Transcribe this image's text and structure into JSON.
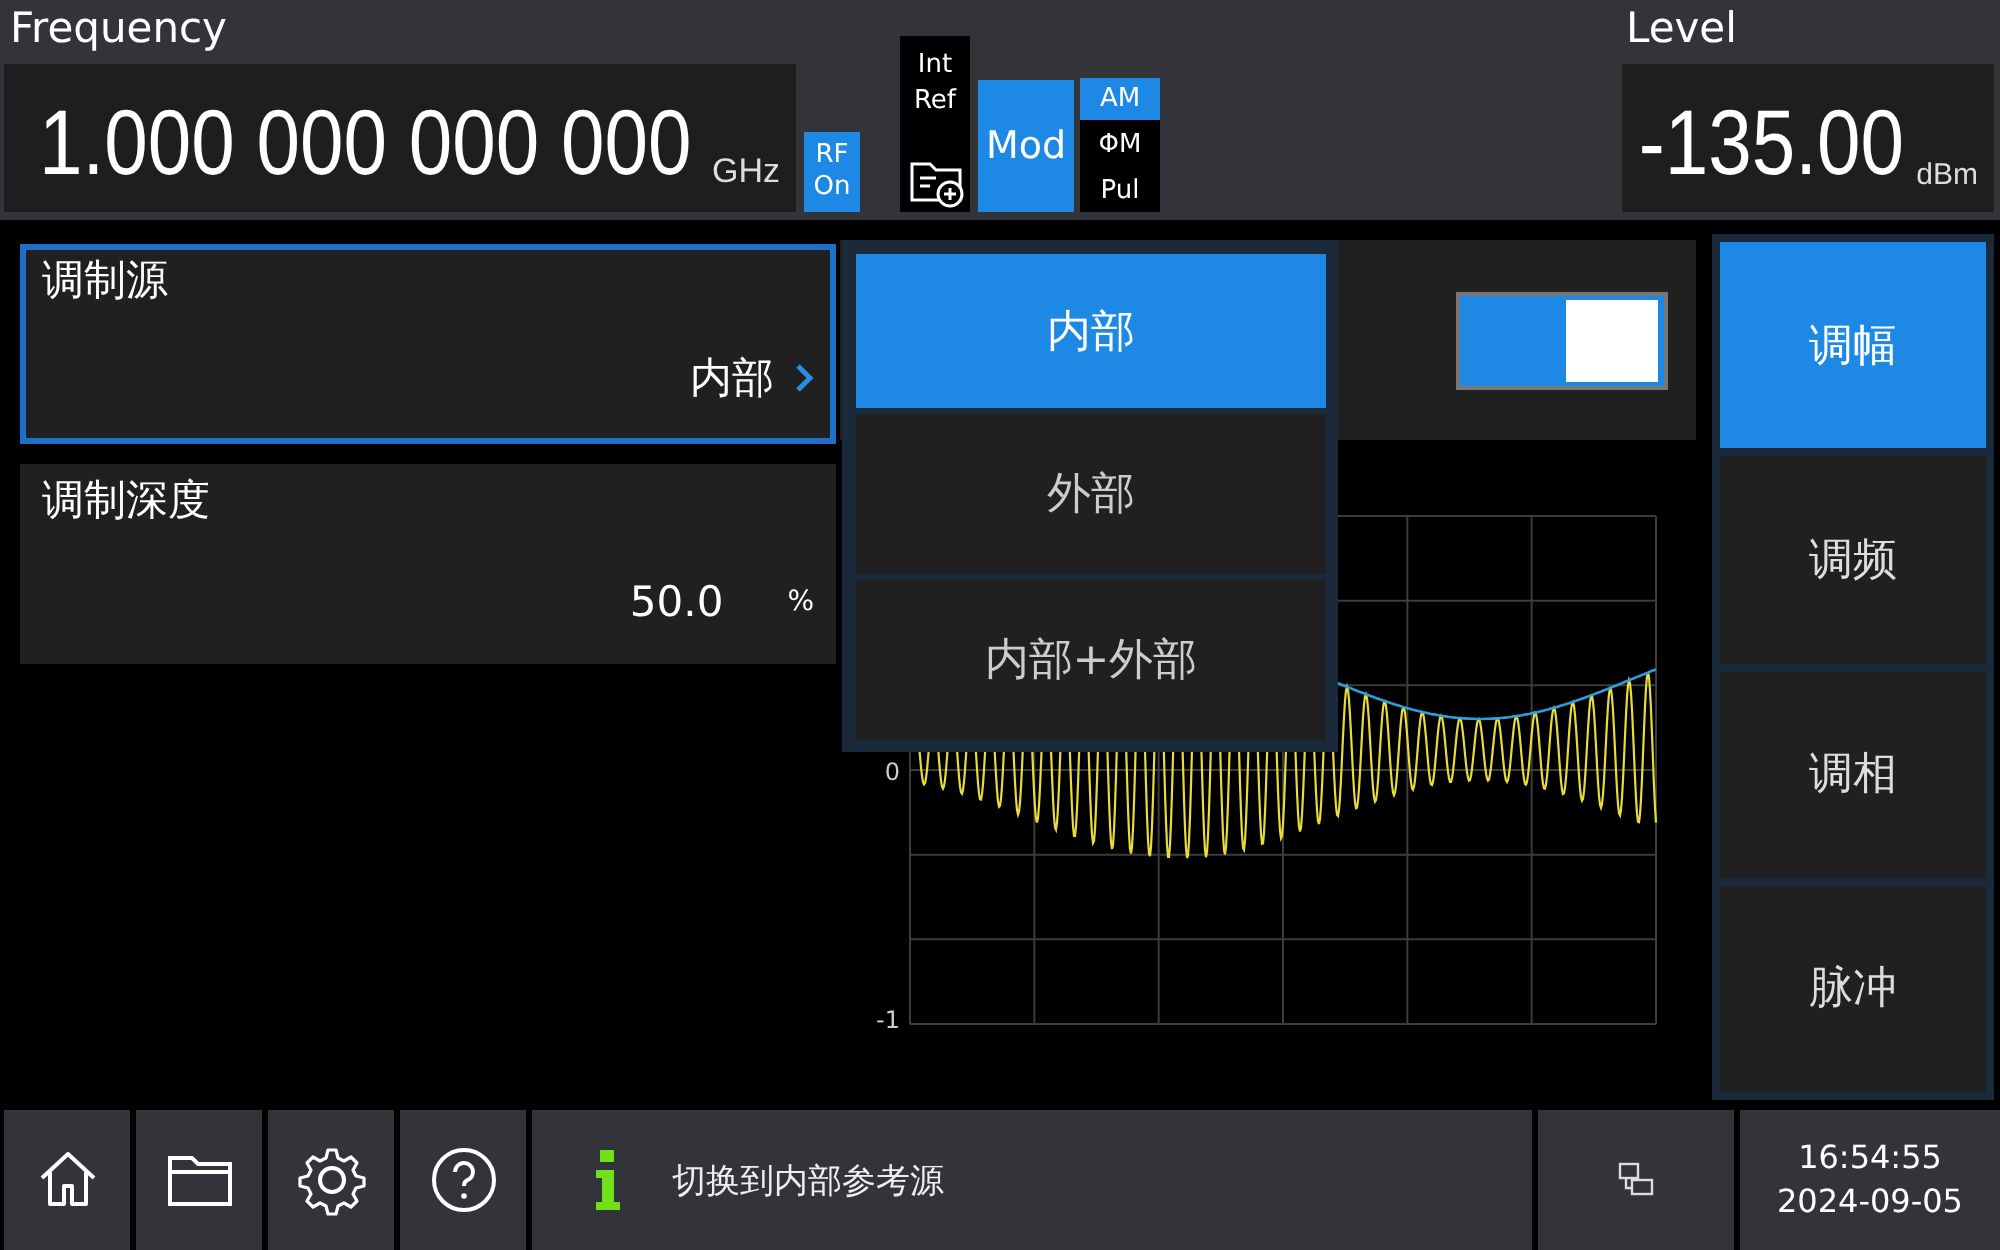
{
  "header": {
    "frequency_label": "Frequency",
    "frequency_value": "1.000 000 000 000",
    "frequency_unit": "GHz",
    "rf_badge": {
      "line1": "RF",
      "line2": "On",
      "on": true
    },
    "ref": {
      "line1": "Int",
      "line2": "Ref"
    },
    "mod_button": {
      "label": "Mod",
      "on": true
    },
    "mod_types": [
      {
        "label": "AM",
        "selected": true
      },
      {
        "label": "ΦM",
        "selected": false
      },
      {
        "label": "Pul",
        "selected": false
      }
    ],
    "level_label": "Level",
    "level_value": "-135.00",
    "level_unit": "dBm"
  },
  "params": [
    {
      "label": "调制源",
      "value": "内部",
      "kind": "select",
      "selected": true
    },
    {
      "label": "调制深度",
      "value": "50.0",
      "unit": "%",
      "kind": "number",
      "selected": false
    }
  ],
  "switch": {
    "on": true
  },
  "chart": {
    "y_labels": [
      "0",
      "-1"
    ]
  },
  "dropdown": [
    {
      "label": "内部",
      "selected": true
    },
    {
      "label": "外部",
      "selected": false
    },
    {
      "label": "内部+外部",
      "selected": false
    }
  ],
  "sidebar": [
    {
      "label": "调幅",
      "selected": true
    },
    {
      "label": "调频",
      "selected": false
    },
    {
      "label": "调相",
      "selected": false
    },
    {
      "label": "脉冲",
      "selected": false
    }
  ],
  "status_bar": {
    "message": "切换到内部参考源",
    "time": "16:54:55",
    "date": "2024-09-05"
  }
}
